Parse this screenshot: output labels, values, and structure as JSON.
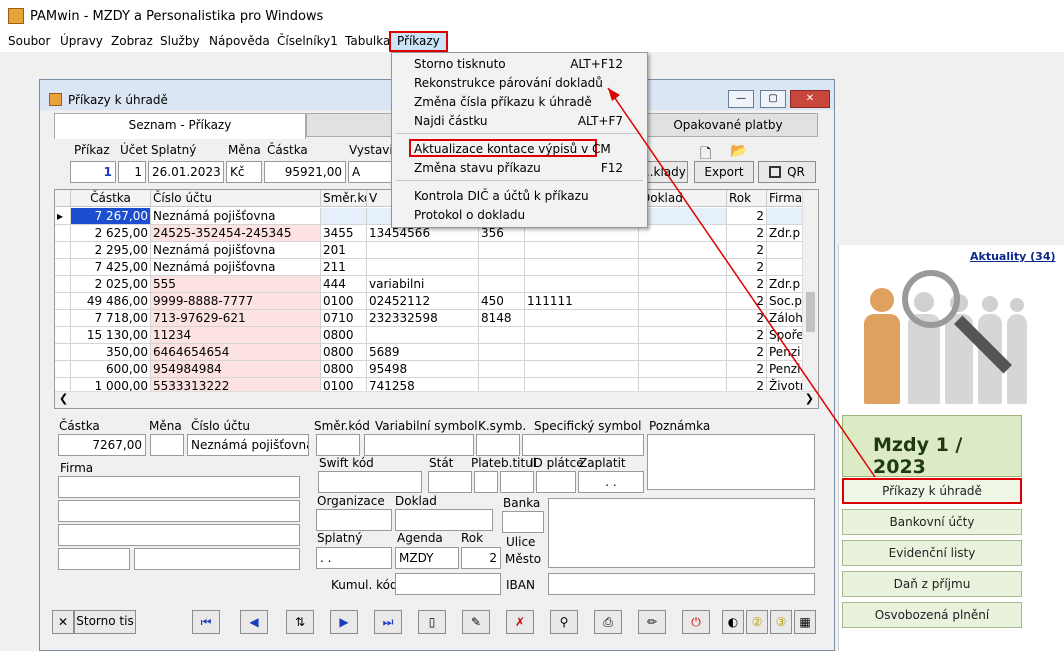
{
  "app": {
    "title": "PAMwin - MZDY a Personalistika pro Windows"
  },
  "menubar": [
    "Soubor",
    "Úpravy",
    "Zobraz",
    "Služby",
    "Nápověda",
    "Číselníky1",
    "Tabulka",
    "Příkazy"
  ],
  "context_menu": {
    "items": [
      {
        "label": "Storno tisknuto",
        "shortcut": "ALT+F12"
      },
      {
        "label": "Rekonstrukce párování dokladů",
        "shortcut": ""
      },
      {
        "label": "Změna čísla příkazu k úhradě",
        "shortcut": ""
      },
      {
        "label": "Najdi částku",
        "shortcut": "ALT+F7"
      },
      {
        "label": "Aktualizace kontace výpisů v CM",
        "shortcut": ""
      },
      {
        "label": "Změna stavu příkazu",
        "shortcut": "F12"
      },
      {
        "label": "Kontrola DIČ a účtů k příkazu",
        "shortcut": ""
      },
      {
        "label": "Protokol o dokladu",
        "shortcut": ""
      }
    ]
  },
  "window": {
    "title": "Příkazy k úhradě",
    "tabs": [
      "Seznam - Příkazy",
      "Opakované platby"
    ],
    "header_labels": {
      "prikaz": "Příkaz",
      "ucet": "Účet",
      "splatny": "Splatný",
      "mena": "Měna",
      "castka": "Částka",
      "vystavil": "Vystavil"
    },
    "header_values": {
      "prikaz": "1",
      "ucet": "1",
      "splatny": "26.01.2023",
      "mena": "Kč",
      "castka": "95921,00",
      "vystavil": "A"
    },
    "buttons": {
      "doklady": "...klady ...",
      "export": "Export",
      "qr": "QR"
    },
    "grid": {
      "columns": [
        "Částka",
        "Číslo účtu",
        "Směr.kód",
        "V",
        "",
        "",
        "Doklad",
        "Rok",
        "Firma"
      ],
      "rows": [
        [
          "7 267,00",
          "Neznámá pojišťovna",
          "",
          "",
          "",
          "",
          "",
          "2",
          ""
        ],
        [
          "2 625,00",
          "24525-352454-245345",
          "3455",
          "13454566",
          "356",
          "",
          "",
          "2",
          "Zdr.p"
        ],
        [
          "2 295,00",
          "Neznámá pojišťovna",
          "201",
          "",
          "",
          "",
          "",
          "2",
          ""
        ],
        [
          "7 425,00",
          "Neznámá pojišťovna",
          "211",
          "",
          "",
          "",
          "",
          "2",
          ""
        ],
        [
          "2 025,00",
          "555",
          "444",
          "variabilni",
          "",
          "",
          "",
          "2",
          "Zdr.p"
        ],
        [
          "49 486,00",
          "9999-8888-7777",
          "0100",
          "02452112",
          "450",
          "111111",
          "",
          "2",
          "Soc.p"
        ],
        [
          "7 718,00",
          "713-97629-621",
          "0710",
          "232332598",
          "8148",
          "",
          "",
          "2",
          "Záloh"
        ],
        [
          "15 130,00",
          "11234",
          "0800",
          "",
          "",
          "",
          "",
          "2",
          "Spoře"
        ],
        [
          "350,00",
          "6464654654",
          "0800",
          "5689",
          "",
          "",
          "",
          "2",
          "Penzi"
        ],
        [
          "600,00",
          "954984984",
          "0800",
          "95498",
          "",
          "",
          "",
          "2",
          "Penzi"
        ],
        [
          "1 000,00",
          "5533313222",
          "0100",
          "741258",
          "",
          "",
          "",
          "2",
          "Životn"
        ]
      ]
    },
    "detail_labels": {
      "castka": "Částka",
      "mena": "Měna",
      "cislo_uctu": "Číslo účtu",
      "smer_kod": "Směr.kód",
      "var_symbol": "Variabilní symbol",
      "k_symb": "K.symb.",
      "spec_symbol": "Specifický symbol",
      "poznamka": "Poznámka",
      "firma": "Firma",
      "swift": "Swift kód",
      "stat": "Stát",
      "plateb_titul": "Plateb.titul",
      "id_platce": "ID plátce",
      "zaplatit": "Zaplatit",
      "organizace": "Organizace",
      "doklad": "Doklad",
      "banka": "Banka",
      "splatny": "Splatný",
      "agenda": "Agenda",
      "rok": "Rok",
      "ulice": "Ulice",
      "mesto": "Město",
      "kumul_kod": "Kumul. kód",
      "iban": "IBAN"
    },
    "detail_values": {
      "castka": "7267,00",
      "cislo_uctu": "Neznámá pojišťovna",
      "zaplatit": ". .",
      "splatny": ". .",
      "agenda": "MZDY",
      "rok": "2"
    },
    "storno_button": "Storno tis"
  },
  "right_panel": {
    "aktuality": "Aktuality (34)",
    "mzdy_period": "Mzdy  1 / 2023",
    "buttons": [
      "Příkazy k úhradě",
      "Bankovní účty",
      "Evidenční listy",
      "Daň z příjmu",
      "Osvobozená plnění"
    ]
  },
  "colors": {
    "highlight_red": "#dd0000",
    "selected_row": "#1b4fd0",
    "pink_cell": "#fde2e2",
    "mzdy_green": "#dcebc5"
  }
}
